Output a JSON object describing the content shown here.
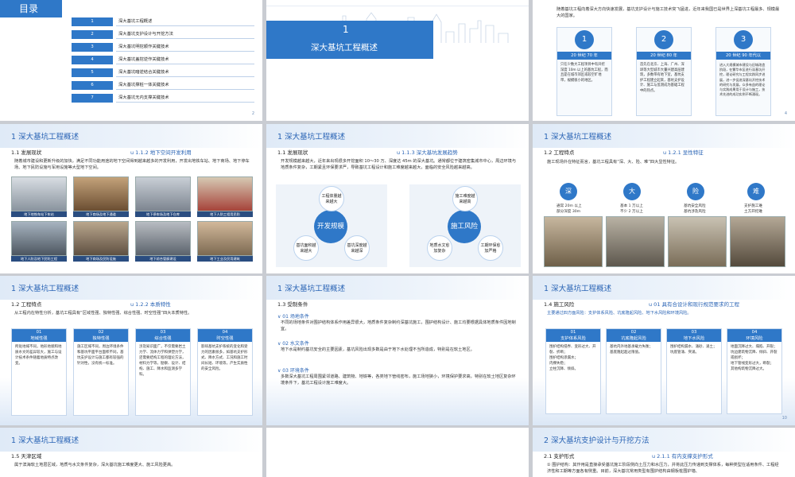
{
  "s1": {
    "title": "目录",
    "toc": [
      {
        "num": "1",
        "label": "深大基坑工程概述"
      },
      {
        "num": "2",
        "label": "深大基坑支护设计与开挖方法"
      },
      {
        "num": "3",
        "label": "深大基坑明挖顺作关键技术"
      },
      {
        "num": "4",
        "label": "深大基坑盖挖逆作关键技术"
      },
      {
        "num": "5",
        "label": "深大基坑暗逆结合关键技术"
      },
      {
        "num": "6",
        "label": "深大基坑撑桩一体关键技术"
      },
      {
        "num": "7",
        "label": "深大基坑无内支撑关键技术"
      }
    ],
    "page": "2"
  },
  "s2": {
    "num": "1",
    "title": "深大基坑工程概述"
  },
  "s3": {
    "intro": "随着基坑工程向着深大方向快速发展，基坑支护设计与施工技术突飞猛进，近年来我国已是世界上深基坑工程最多、规模最大的国家。",
    "steps": [
      {
        "num": "1",
        "era": "20 世纪 70 年",
        "text": "只在少数大工程项目中有开挖深度 10m 以上的基坑工程，而且是在城市郊区或较空旷地带，规模很小的地区。"
      },
      {
        "num": "2",
        "era": "20 世纪 80 年",
        "text": "首先在北京、上海、广州、深圳等大型城市大量兴建高层建筑，多数带有地下室，基坑支护工程建立起来，基坑支护设计、施工与监测成为基础工程中的热点。"
      },
      {
        "num": "3",
        "era": "20 世纪 90 年代以",
        "text": "进入大规模城市建设与旧城改造阶段，在繁华市区进行深基坑开挖，理论研究与工程实践同步进展，进一步促进深基坑开挖技术的研究与发展，众多有益的理论与实践成果用于设计与施工，技术先进的成功实例不断涌现。"
      }
    ],
    "page": "4"
  },
  "s4": {
    "header": "1   深大基坑工程概述",
    "sub": "1.1   发展现状",
    "tag": "u   1.1.2   地下空间开发利用",
    "para": "随着城市建设和更新升级的加快，满足不同功能用途的地下空间得到越来越多的开发利用，开发出地铁车站、地下商场、地下停车场、地下民防设施与军用设施等大型地下空间。",
    "captions": [
      "地下地铁车站下车站",
      "地下商场及地下通道",
      "地下停车场及地下仓库",
      "地下人防工程用民防",
      "地下人防及地下民防工程",
      "地下商场及民防设施",
      "地下综合管廊建设",
      "地下工业及民用建筑"
    ]
  },
  "s5": {
    "header": "1   深大基坑工程概述",
    "sub": "1.1   发展现状",
    "tag": "u   1.1.3   深大基坑发展趋势",
    "para": "开发规模越来越大，近年来出现很多开挖面积 10～30 万、深度达 45m 的深大基坑。通常都位于建筑密集城市中心，周边环境与地质条件复杂，工期紧且环保要求严，导致基坑工程设计和施工难度越来越大，面临的安全风险越来越高。",
    "left": {
      "center": "开发规模",
      "top": "工程体量越来越大",
      "bl": "基坑面积越来越大",
      "br": "基坑深度越来越深"
    },
    "right": {
      "center": "施工风险",
      "top": "施工难度越来越高",
      "bl": "地质水文愈加复杂",
      "br": "工期环保愈加严格"
    }
  },
  "s6": {
    "header": "1   深大基坑工程概述",
    "sub": "1.2   工程特点",
    "tag": "u   1.2.1   显性特征",
    "para": "施工现场外在特征而言，基坑工程具有“深、大、险、难”四大显性特征。",
    "feats": [
      "深",
      "大",
      "险",
      "难"
    ],
    "notes": [
      [
        "通常 20m 以上",
        "部分深度 30m"
      ],
      [
        "基本 1 万以上",
        "不少 2 万以上"
      ],
      [
        "基坑安全风险",
        "基坑涉及风险"
      ],
      [
        "支护施工难",
        "土方开挖难"
      ]
    ]
  },
  "s7": {
    "header": "1   深大基坑工程概述",
    "sub": "1.2   工程特点",
    "tag": "u   1.2.2   本质特性",
    "para": "从工程内在特性分析，基坑工程具有“区域性强、独特性强、综合性强、时空性强”四大本质特性。",
    "cards": [
      {
        "num": "01",
        "name": "地域性强",
        "text": "所处地域不同，地形地貌和地质水文的差异较大，施工与设计技术条件随着地质特点改变。"
      },
      {
        "num": "02",
        "name": "独特性强",
        "text": "施工区域不同，周边环境条件和基坑平面平台面积不同，基坑支护设计与施工都有较强的针对性，没有统一标准。"
      },
      {
        "num": "03",
        "name": "综合性强",
        "text": "涉及知识面广，不仅需要岩土力学、流体力学和弹塑力学，还需要结构工程的理论方法，材料力学等，勘察、设计、结构、施工、降水和监测多学科。"
      },
      {
        "num": "04",
        "name": "时空性强",
        "text": "影响基坑支护系统的变化和受力的因素很多，如基坑支护形式、降水方式、工况和施工时间长短、环境等，产生实质性的安全风险。"
      }
    ]
  },
  "s8": {
    "header": "1   深大基坑工程概述",
    "sub": "1.3   受制条件",
    "sections": [
      {
        "head": "∨   01   场地条件",
        "text": "不同的场地条件对围护结构体系作用差异很大，地质条件复杂制约深基坑施工，围护结构设计、施工均要根据具体地质条件因地制宜。"
      },
      {
        "head": "∨   02   水文条件",
        "text": "地下水是制约基坑安全的主要因素，基坑风险出现多数是由于地下水处理不当所造成，特别是在软土地区。"
      },
      {
        "head": "∨   03   环境条件",
        "text": "多数深大基坑工程周围紧邻道路、建筑物、地铁等，各类地下管线密布，施工场地狭小，环境保护要求高，特别在软土地区复杂环境条件下，基坑工程设计施工难度大。"
      }
    ]
  },
  "s9": {
    "header": "1   深大基坑工程概述",
    "sub": "1.4   施工风险",
    "tag": "u   01   具有合设计和现行规范要求的工程",
    "intro": "主要通过四方面风险：支护体系风险、坑底隆起风险、地下水风险和环境风险。",
    "cards": [
      {
        "num": "01",
        "name": "支护体系风险",
        "items": [
          "围护结构侵界、变形过大、开裂、折断；",
          "围护结构渗漏水；",
          "内撑失稳；",
          "立柱沉降、倾斜。"
        ]
      },
      {
        "num": "02",
        "name": "坑底隆起风险",
        "items": [
          "基坑内外地基承载力失衡；",
          "基底隆起超过限值。"
        ]
      },
      {
        "num": "03",
        "name": "地下水风险",
        "items": [
          "围护结构漏水、涌砂、涌土；",
          "坑底管涌、突涌。"
        ]
      },
      {
        "num": "04",
        "name": "环境风险",
        "items": [
          "地面沉降过大、塌陷、开裂；",
          "坑边建筑物沉降、倾斜、开裂或损坏；",
          "地下管线变形过大，断裂；",
          "其他构筑物沉降过大。"
        ]
      }
    ],
    "page": "10"
  },
  "s10": {
    "header": "1   深大基坑工程概述",
    "sub": "1.5   天津区域",
    "para": "属于滨海软土地层区域，地质与水文条件复杂，深大基坑施工难度更大、施工风险更高。"
  },
  "s12": {
    "header": "2   深大基坑支护设计与开挖方法",
    "sub": "2.1   支护形式",
    "tag": "u   2.1.1   有内支撑支护形式",
    "para": "① 围护结构：其作用是直接承受基坑施工阶段侧向土压力和水压力，并将此压力传递到支撑体系，每种类型在适用条件、工程经济性和工期等方面各有侧重。目前，深大基坑常用类型有围护结构由钢板桩围护墙、"
  }
}
